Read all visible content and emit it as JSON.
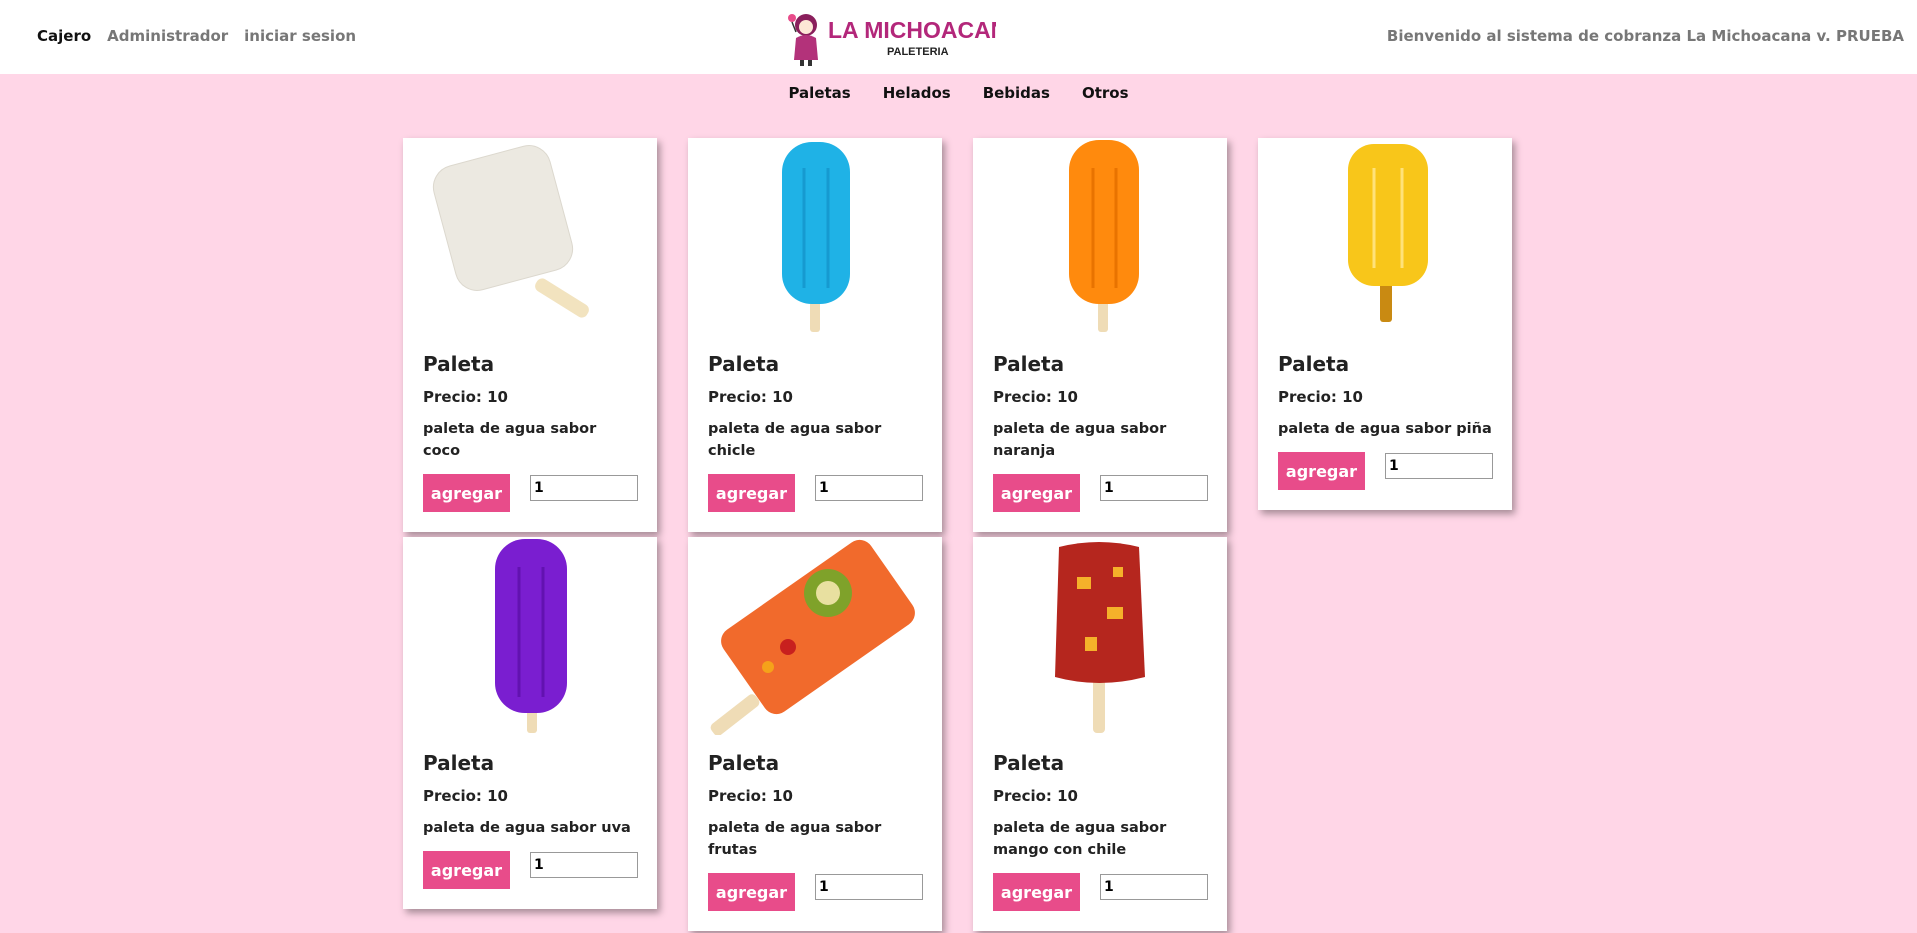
{
  "header": {
    "nav": [
      "Cajero",
      "Administrador",
      "iniciar sesion"
    ],
    "logo_text": "LA MICHOACANA",
    "logo_sub": "PALETERIA",
    "welcome": "Bienvenido al sistema de cobranza La Michoacana v. PRUEBA"
  },
  "categories": [
    "Paletas",
    "Helados",
    "Bebidas",
    "Otros"
  ],
  "products": [
    {
      "title": "Paleta",
      "price": "Precio: 10",
      "desc": "paleta de agua sabor coco",
      "button": "agregar",
      "qty": "1",
      "color": "#ece9e1"
    },
    {
      "title": "Paleta",
      "price": "Precio: 10",
      "desc": "paleta de agua sabor chicle",
      "button": "agregar",
      "qty": "1",
      "color": "#1fb2e6"
    },
    {
      "title": "Paleta",
      "price": "Precio: 10",
      "desc": "paleta de agua sabor naranja",
      "button": "agregar",
      "qty": "1",
      "color": "#ff8a0d"
    },
    {
      "title": "Paleta",
      "price": "Precio: 10",
      "desc": "paleta de agua sabor piña",
      "button": "agregar",
      "qty": "1",
      "color": "#f8c61a"
    },
    {
      "title": "Paleta",
      "price": "Precio: 10",
      "desc": "paleta de agua sabor uva",
      "button": "agregar",
      "qty": "1",
      "color": "#7a1ed0"
    },
    {
      "title": "Paleta",
      "price": "Precio: 10",
      "desc": "paleta de agua sabor frutas",
      "button": "agregar",
      "qty": "1",
      "color": "#f16a2c"
    },
    {
      "title": "Paleta",
      "price": "Precio: 10",
      "desc": "paleta de agua sabor mango con chile",
      "button": "agregar",
      "qty": "1",
      "color": "#b5261e"
    }
  ]
}
